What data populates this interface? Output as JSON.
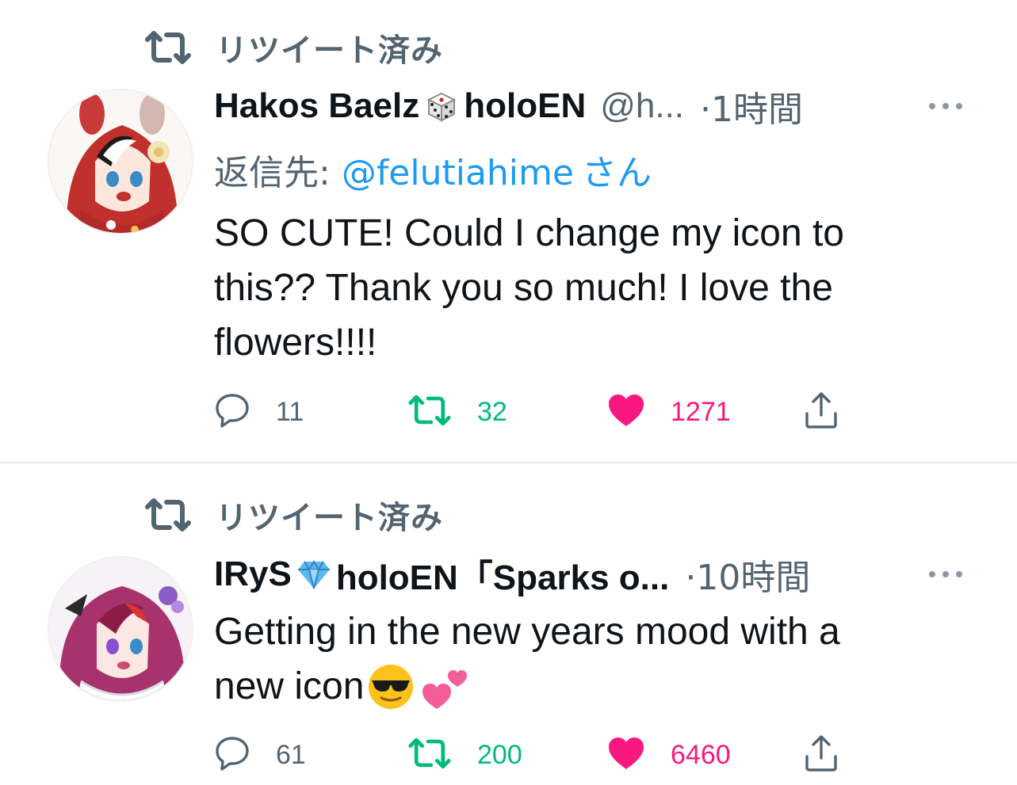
{
  "tweets": [
    {
      "retweeted_label": "リツイート済み",
      "display_name_part1": "Hakos Baelz",
      "display_name_part2": "holoEN",
      "name_emoji": "dice-emoji",
      "handle": "@h...",
      "time": "·1時間",
      "reply_prefix": "返信先: ",
      "reply_mention": "@felutiahime",
      "reply_suffix": "さん",
      "text_lines": [
        "SO CUTE! Could I change my icon to",
        "this?? Thank you so much!  I love the",
        "flowers!!!!"
      ],
      "stats": {
        "replies": "11",
        "retweets": "32",
        "likes": "1271"
      },
      "liked": true,
      "retweeted": true
    },
    {
      "retweeted_label": "リツイート済み",
      "display_name_part1": "IRyS",
      "display_name_part2": "holoEN「Sparks o...",
      "name_emoji": "gem-emoji",
      "time": "·10時間",
      "text_lines": [
        "Getting in the new years mood with a",
        "new icon"
      ],
      "text_emojis": [
        "sunglasses-emoji",
        "two-hearts-emoji"
      ],
      "stats": {
        "replies": "61",
        "retweets": "200",
        "likes": "6460"
      },
      "liked": true,
      "retweeted": true
    }
  ],
  "colors": {
    "text": "#0f1419",
    "secondary": "#536471",
    "link": "#1d9bf0",
    "retweet": "#00ba7c",
    "like": "#f91880",
    "divider": "#e6e8ea"
  }
}
